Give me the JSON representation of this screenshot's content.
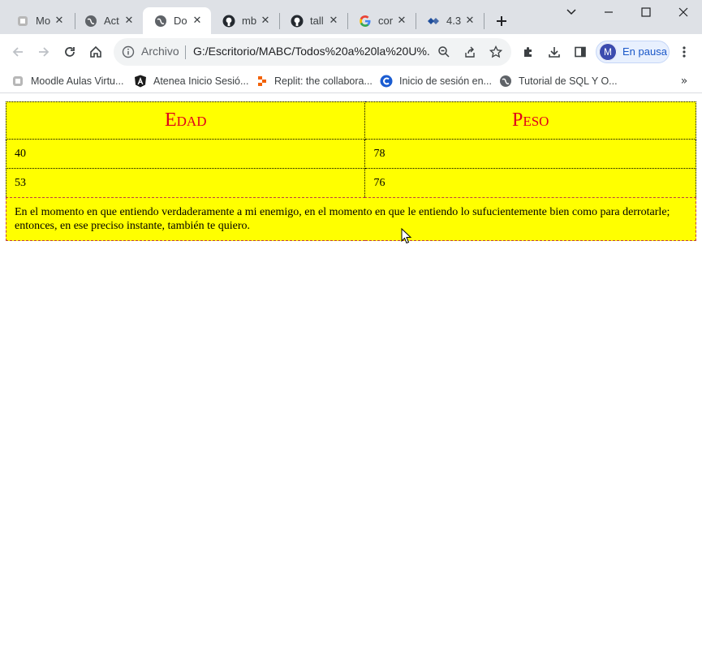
{
  "browser": {
    "tabs": [
      {
        "title": "Mo",
        "icon": "moodle-favicon",
        "active": false
      },
      {
        "title": "Act",
        "icon": "globe-favicon",
        "active": false
      },
      {
        "title": "Do",
        "icon": "globe-favicon",
        "active": true
      },
      {
        "title": "mb",
        "icon": "github-favicon",
        "active": false
      },
      {
        "title": "tall",
        "icon": "github-favicon",
        "active": false
      },
      {
        "title": "cor",
        "icon": "google-favicon",
        "active": false
      },
      {
        "title": "4.3",
        "icon": "diamond-favicon",
        "active": false
      }
    ],
    "address": {
      "label": "Archivo",
      "url": "G:/Escritorio/MABC/Todos%20a%20la%20U%..."
    },
    "profile": {
      "initial": "M",
      "status": "En pausa"
    },
    "bookmarks": [
      {
        "label": "Moodle Aulas Virtu...",
        "icon": "moodle-favicon"
      },
      {
        "label": "Atenea Inicio Sesió...",
        "icon": "angular-favicon"
      },
      {
        "label": "Replit: the collabora...",
        "icon": "replit-favicon"
      },
      {
        "label": "Inicio de sesión en...",
        "icon": "c-favicon"
      },
      {
        "label": "Tutorial de SQL Y O...",
        "icon": "globe-favicon"
      }
    ],
    "bookmarks_more": "»"
  },
  "page": {
    "table": {
      "headers": [
        "Edad",
        "Peso"
      ],
      "rows": [
        [
          "40",
          "78"
        ],
        [
          "53",
          "76"
        ]
      ],
      "quote": "En el momento en que entiendo verdaderamente a mi enemigo, en el momento en que le entiendo lo sufucientemente bien como para derrotarle; entonces, en ese preciso instante, también te quiero."
    }
  },
  "colors": {
    "table_background": "#ffff00",
    "header_text": "#e0001b",
    "tab_strip": "#dee1e6",
    "profile_accent": "#1a57c8"
  }
}
